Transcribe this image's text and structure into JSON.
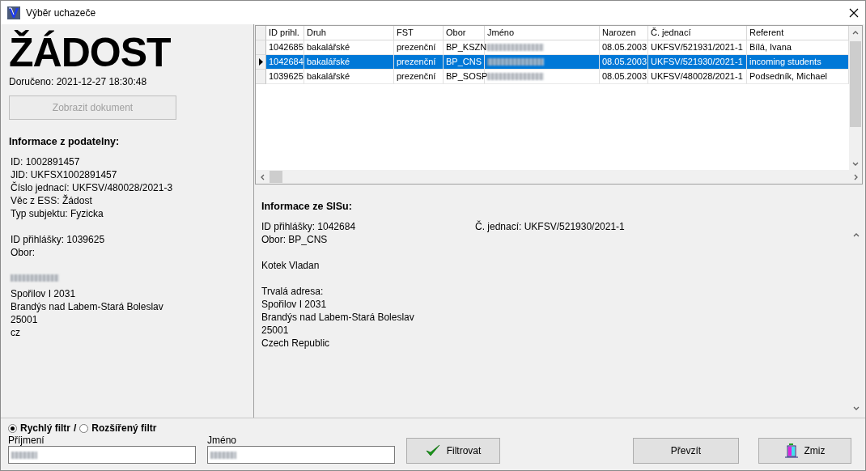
{
  "window": {
    "title": "Výběr uchazeče"
  },
  "left": {
    "heading": "ŽÁDOST",
    "delivered": "Doručeno: 2021-12-27 18:30:48",
    "show_document_button": {
      "label": "Zobrazit dokument",
      "disabled": true
    },
    "section_title": "Informace z podatelny:",
    "groups": [
      {
        "lines": [
          {
            "kind": "text",
            "text": "ID: 1002891457"
          },
          {
            "kind": "text",
            "text": "JID: UKFSX1002891457"
          },
          {
            "kind": "text",
            "text": "Číslo jednací: UKFSV/480028/2021-3"
          },
          {
            "kind": "text",
            "text": "Věc z ESS: Žádost"
          },
          {
            "kind": "text",
            "text": "Typ subjektu: Fyzicka"
          }
        ]
      },
      {
        "lines": [
          {
            "kind": "text",
            "text": "ID přihlášky: 1039625"
          },
          {
            "kind": "text",
            "text": "Obor:"
          }
        ]
      },
      {
        "lines": [
          {
            "kind": "redacted"
          },
          {
            "kind": "text",
            "text": "Spořilov I 2031"
          },
          {
            "kind": "text",
            "text": "Brandýs nad Labem-Stará Boleslav"
          },
          {
            "kind": "text",
            "text": "25001"
          },
          {
            "kind": "text",
            "text": "cz"
          }
        ]
      }
    ]
  },
  "table": {
    "columns": [
      "ID prihl.",
      "Druh",
      "FST",
      "Obor",
      "Jméno",
      "Narozen",
      "Č. jednací",
      "Referent"
    ],
    "rows": [
      {
        "selected": false,
        "cells": [
          {
            "kind": "text",
            "text": "1042685"
          },
          {
            "kind": "text",
            "text": "bakalářské"
          },
          {
            "kind": "text",
            "text": "prezenční"
          },
          {
            "kind": "text",
            "text": "BP_KSZN"
          },
          {
            "kind": "redacted"
          },
          {
            "kind": "text",
            "text": "08.05.2003"
          },
          {
            "kind": "text",
            "text": "UKFSV/521931/2021-1"
          },
          {
            "kind": "text",
            "text": "Bílá, Ivana"
          }
        ]
      },
      {
        "selected": true,
        "cells": [
          {
            "kind": "text",
            "text": "1042684"
          },
          {
            "kind": "text",
            "text": "bakalářské"
          },
          {
            "kind": "text",
            "text": "prezenční"
          },
          {
            "kind": "text",
            "text": "BP_CNS"
          },
          {
            "kind": "redacted"
          },
          {
            "kind": "text",
            "text": "08.05.2003"
          },
          {
            "kind": "text",
            "text": "UKFSV/521930/2021-1"
          },
          {
            "kind": "text",
            "text": "incoming students"
          }
        ]
      },
      {
        "selected": false,
        "cells": [
          {
            "kind": "text",
            "text": "1039625"
          },
          {
            "kind": "text",
            "text": "bakalářské"
          },
          {
            "kind": "text",
            "text": "prezenční"
          },
          {
            "kind": "text",
            "text": "BP_SOSP"
          },
          {
            "kind": "redacted"
          },
          {
            "kind": "text",
            "text": "08.05.2003"
          },
          {
            "kind": "text",
            "text": "UKFSV/480028/2021-1"
          },
          {
            "kind": "text",
            "text": "Podsedník, Michael"
          }
        ]
      }
    ]
  },
  "sis": {
    "title": "Informace ze SISu:",
    "groups": [
      {
        "lines": [
          "ID přihlášky: 1042684",
          "Obor: BP_CNS"
        ]
      },
      {
        "lines": [
          "Kotek Vladan"
        ]
      },
      {
        "lines": [
          "Trvalá adresa:",
          "Spořilov I 2031",
          "Brandýs nad Labem-Stará Boleslav",
          "25001",
          "Czech Republic"
        ]
      }
    ],
    "right_lines": [
      "Č. jednací: UKFSV/521930/2021-1"
    ]
  },
  "filter": {
    "modes": [
      {
        "label": "Rychlý filtr",
        "selected": true
      },
      {
        "label": "Rozšířený filtr",
        "selected": false
      }
    ],
    "separator": "/",
    "fields": [
      {
        "label": "Příjmení"
      },
      {
        "label": "Jméno"
      }
    ],
    "filter_button": "Filtrovat",
    "take_button": "Převzít",
    "close_button": "Zmiz"
  }
}
